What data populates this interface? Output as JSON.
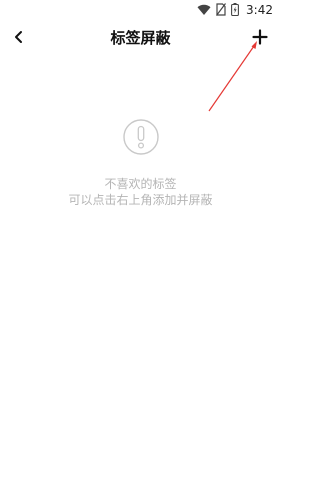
{
  "status_bar": {
    "time": "3:42",
    "icons": [
      "wifi-icon",
      "no-sim-icon",
      "battery-icon"
    ]
  },
  "header": {
    "title": "标签屏蔽",
    "back_icon": "chevron-left-icon",
    "add_icon": "plus-icon"
  },
  "empty_state": {
    "icon": "exclamation-circle-icon",
    "title": "不喜欢的标签",
    "hint": "可以点击右上角添加并屏蔽"
  },
  "colors": {
    "background": "#ffffff",
    "text_primary": "#111111",
    "text_muted": "#b5b5b5",
    "annotation_arrow": "#e53935"
  }
}
